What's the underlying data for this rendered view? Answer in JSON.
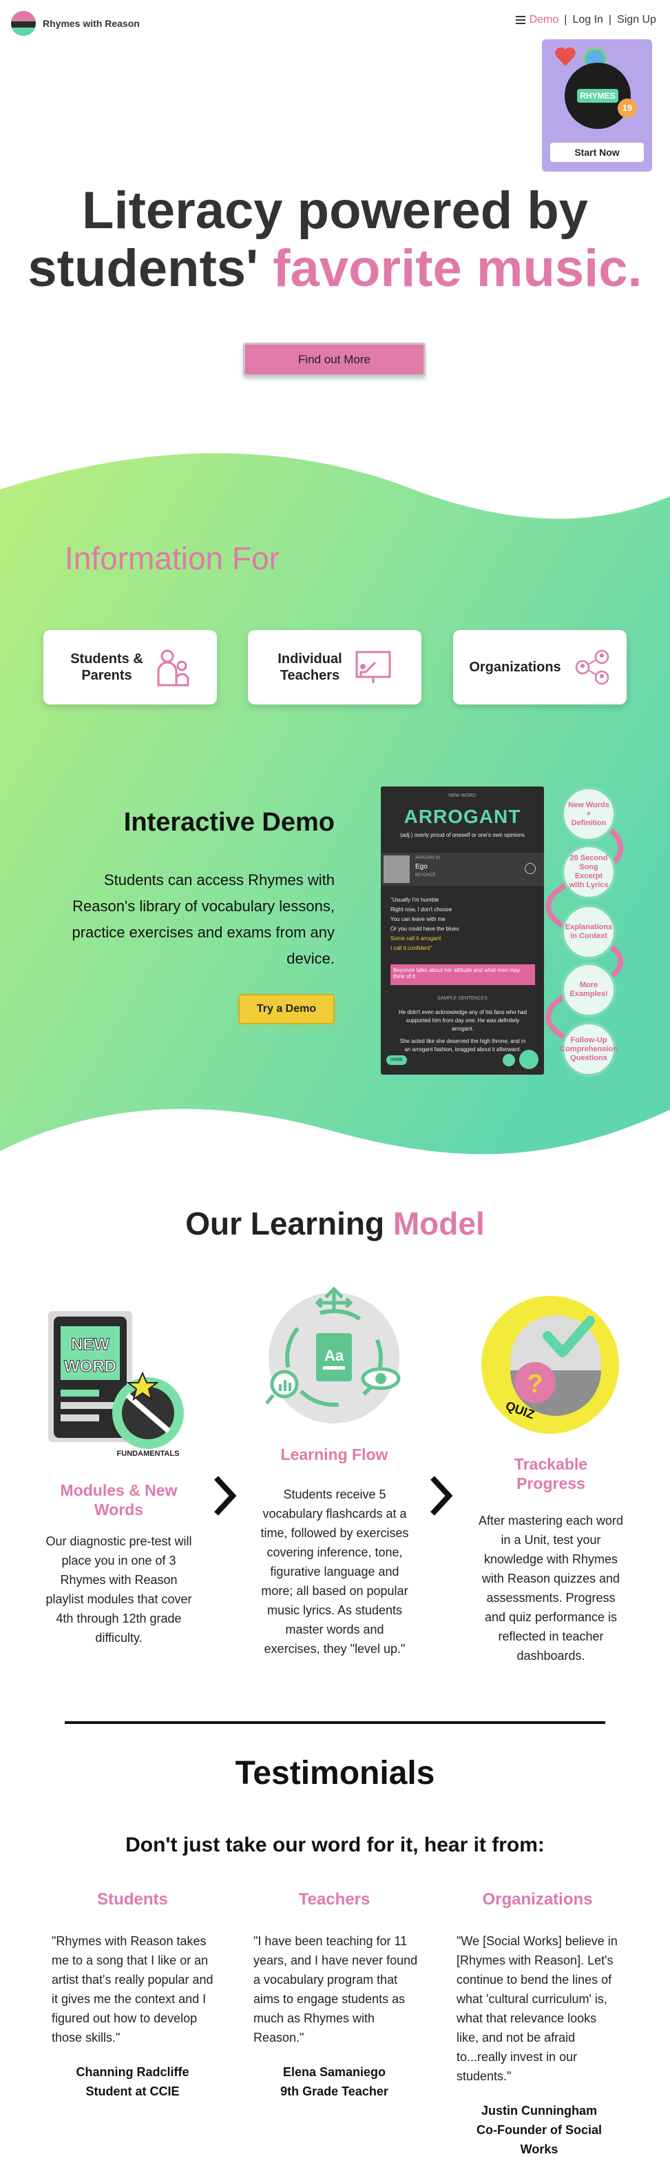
{
  "header": {
    "brand": "Rhymes with Reason",
    "nav": {
      "demo": "Demo",
      "login": "Log In",
      "signup": "Sign Up",
      "sep": "|"
    }
  },
  "promo": {
    "disc_label": "RHYMES",
    "year": "19",
    "button": "Start Now"
  },
  "hero": {
    "line1": "Literacy powered by",
    "line2_plain": "students'",
    "line2_pink": "favorite music.",
    "button": "Find out More"
  },
  "info": {
    "title": "Information For",
    "cards": [
      {
        "label_line1": "Students &",
        "label_line2": "Parents",
        "icon": "people-icon"
      },
      {
        "label_line1": "Individual",
        "label_line2": "Teachers",
        "icon": "teacher-board-icon"
      },
      {
        "label_line1": "Organizations",
        "label_line2": "",
        "icon": "network-icon"
      }
    ]
  },
  "demo": {
    "title": "Interactive Demo",
    "text": "Students can access Rhymes with Reason's library of vocabulary lessons, practice exercises and exams from any device.",
    "button": "Try a Demo",
    "phone": {
      "header": "NEW WORD",
      "word": "ARROGANT",
      "definition": "(adj.) overly proud of oneself or one's own opinions",
      "song_by": "APPEARS IN",
      "song_title": "Ego",
      "artist": "BEYONCÉ",
      "lyrics": [
        "\"Usually I'm humble",
        "Right now, I don't choose",
        "You can leave with me",
        "Or you could have the blues",
        "Some call it arrogant",
        "I call it confident\""
      ],
      "highlight": "Beyoncé talks about her attitude and what men may think of it.",
      "example_label": "SAMPLE SENTENCES",
      "examples": [
        "He didn't even acknowledge any of his fans who had supported him from day one. He was definitely arrogant.",
        "She acted like she deserved the high throne, and in an arrogant fashion, bragged about it afterward."
      ],
      "back": "HOME"
    },
    "features": [
      "New Words + Definition",
      "20 Second Song Excerpt with Lyrics",
      "Explanations in Context",
      "More Examples!",
      "Follow-Up Comprehension Questions"
    ]
  },
  "model": {
    "title_plain": "Our Learning",
    "title_pink": "Model",
    "columns": [
      {
        "title": "Modules & New Words",
        "badge_top": "NEW",
        "badge_bottom": "WORD",
        "ring": "FUNDAMENTALS",
        "text": "Our diagnostic pre-test will place you in one of 3 Rhymes with Reason playlist modules that cover 4th through 12th grade difficulty."
      },
      {
        "title": "Learning Flow",
        "card": "Aa",
        "text": "Students receive 5 vocabulary flashcards at a time, followed by exercises covering inference, tone, figurative language and more; all based on popular music lyrics. As students master words and exercises, they \"level up.\""
      },
      {
        "title": "Trackable Progress",
        "quiz": "QUIZ",
        "text": "After mastering each word in a Unit, test your knowledge with Rhymes with Reason quizzes and assessments. Progress and quiz performance is reflected in teacher dashboards."
      }
    ]
  },
  "testimonials": {
    "title": "Testimonials",
    "subtitle": "Don't just take our word for it, hear it from:",
    "items": [
      {
        "category": "Students",
        "quote": "\"Rhymes with Reason takes me to a song that I like or an artist that's really popular and it gives me the context and I figured out how to develop those skills.\"",
        "name": "Channing Radcliffe",
        "role": "Student at CCIE"
      },
      {
        "category": "Teachers",
        "quote": "\"I have been teaching for 11 years, and I have never found a vocabulary program that aims to engage students as much as Rhymes with Reason.\"",
        "name": "Elena Samaniego",
        "role": "9th Grade Teacher"
      },
      {
        "category": "Organizations",
        "quote": "\"We [Social Works] believe in [Rhymes with Reason]. Let's continue to bend the lines of what 'cultural curriculum' is, what that relevance looks like, and not be afraid to...really invest in our students.\"",
        "name": "Justin Cunningham",
        "role": "Co-Founder of Social Works"
      }
    ]
  },
  "colors": {
    "pink": "#e07aa8",
    "green": "#5fd6a6",
    "yellow": "#f2cc37"
  }
}
